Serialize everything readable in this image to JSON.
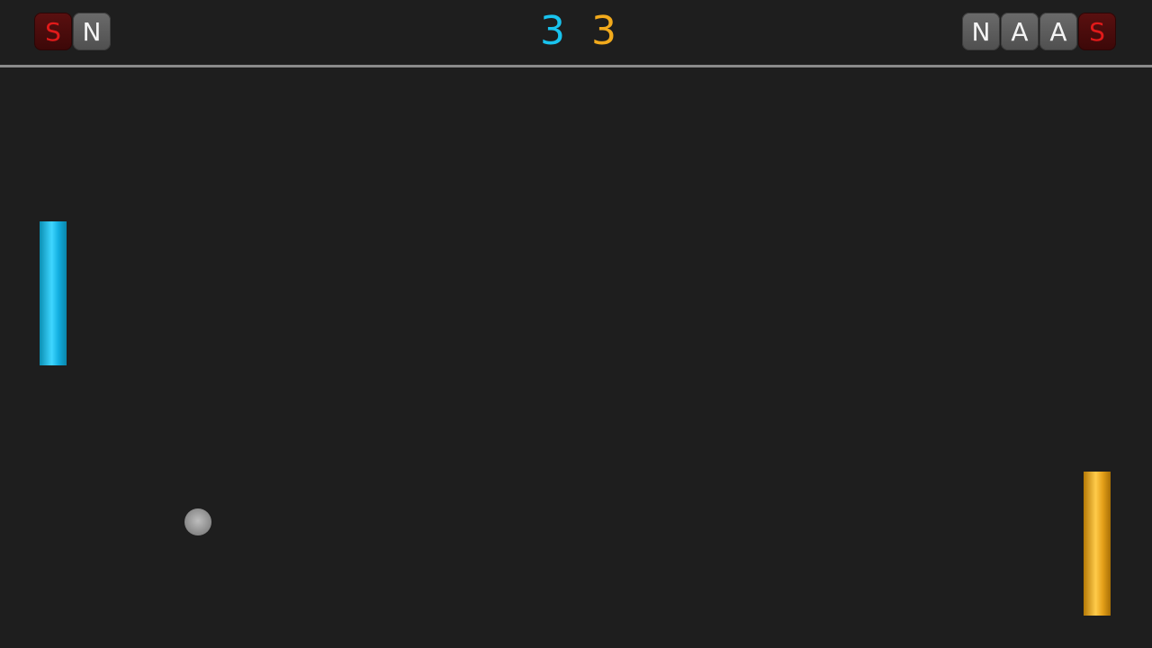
{
  "hud": {
    "player1_powerups": [
      {
        "label": "S",
        "style": "red"
      },
      {
        "label": "N",
        "style": "gray"
      }
    ],
    "player2_powerups": [
      {
        "label": "N",
        "style": "gray"
      },
      {
        "label": "A",
        "style": "gray"
      },
      {
        "label": "A",
        "style": "gray"
      },
      {
        "label": "S",
        "style": "red"
      }
    ],
    "score": {
      "player1": "3",
      "player2": "3"
    }
  },
  "colors": {
    "background": "#1e1e1e",
    "player1": "#19c3ee",
    "player2": "#f2aa1c",
    "divider": "#8a8a8a",
    "ball": "#9a9a9a"
  }
}
